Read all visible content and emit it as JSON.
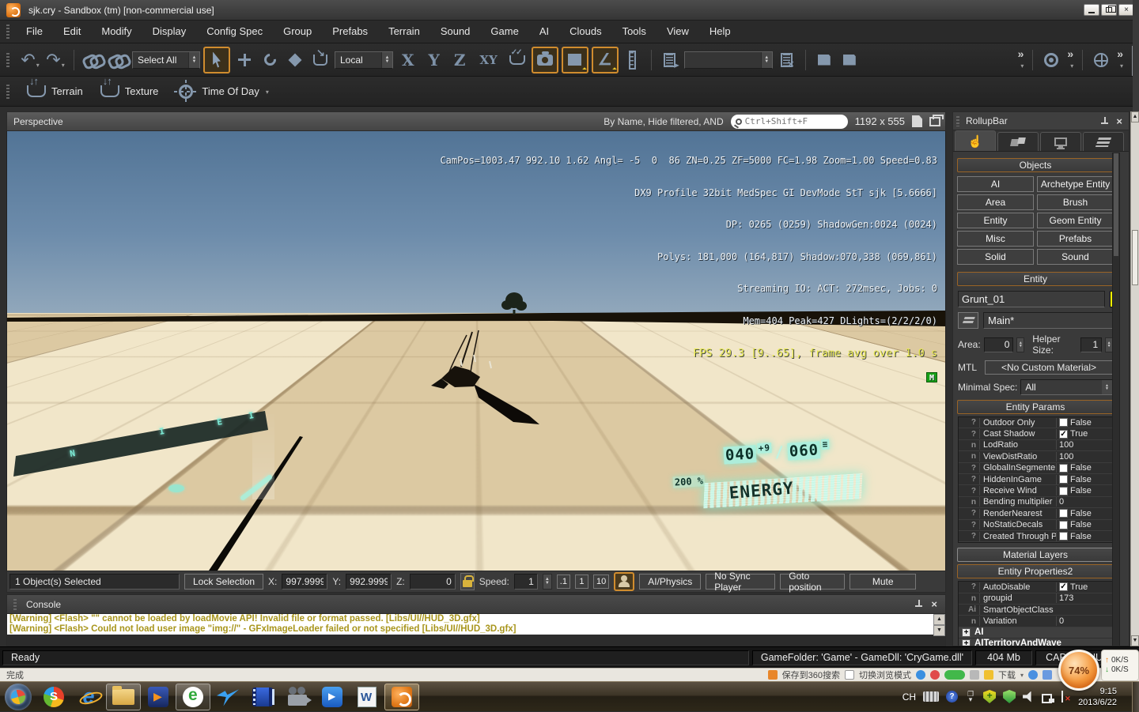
{
  "window": {
    "title": "sjk.cry - Sandbox (tm) [non-commercial use]"
  },
  "menu": [
    "File",
    "Edit",
    "Modify",
    "Display",
    "Config Spec",
    "Group",
    "Prefabs",
    "Terrain",
    "Sound",
    "Game",
    "AI",
    "Clouds",
    "Tools",
    "View",
    "Help"
  ],
  "toolbar": {
    "select_mode": "Select All",
    "coord_system": "Local",
    "axes": [
      "X",
      "Y",
      "Z",
      "XY"
    ],
    "overflow_glyph": "»"
  },
  "toolbar2": {
    "terrain": "Terrain",
    "texture": "Texture",
    "time_of_day": "Time Of Day"
  },
  "viewport": {
    "title": "Perspective",
    "filter_label": "By Name, Hide filtered, AND",
    "search_placeholder": "Ctrl+Shift+F",
    "resolution": "1192 x 555",
    "stats": [
      "CamPos=1003.47 992.10 1.62 Angl= -5  0  86 ZN=0.25 ZF=5000 FC=1.98 Zoom=1.00 Speed=0.83",
      "DX9 Profile 32bit MedSpec GI DevMode StT sjk [5.6666]",
      "DP: 0265 (0259) ShadowGen:0024 (0024)",
      "Polys: 181,000 (164,817) Shadow:070,338 (069,861)",
      "Streaming IO: ACT: 272msec, Jobs: 0",
      "Mem=404 Peak=427 DLights=(2/2/2/0)"
    ],
    "fps_line": "FPS 29.3 [9..65], frame avg over 1.0 s",
    "memory_badge": "M",
    "hud": {
      "ammo_left": "040",
      "ammo_mod": "+9",
      "ammo_sep": "/",
      "ammo_right": "060",
      "mag_glyph": "≡",
      "percent": "200 %",
      "energy_label": "ENERGY",
      "compass": [
        "N",
        "I",
        "E",
        "I"
      ]
    }
  },
  "selbar": {
    "selected_info": "1 Object(s) Selected",
    "lock_selection": "Lock Selection",
    "x_label": "X:",
    "x_value": "997.9999",
    "y_label": "Y:",
    "y_value": "992.9999",
    "z_label": "Z:",
    "z_value": "0",
    "speed_label": "Speed:",
    "speed_value": "1",
    "presets": [
      ".1",
      "1",
      "10"
    ],
    "buttons": [
      "AI/Physics",
      "No Sync Player",
      "Goto position",
      "Mute"
    ]
  },
  "console": {
    "title": "Console",
    "lines": [
      "[Warning] <Flash> \"\" cannot be loaded by loadMovie API! Invalid file or format passed. [Libs/UI//HUD_3D.gfx]",
      "[Warning] <Flash> Could not load user image \"img://\" - GFxImageLoader failed or not specified [Libs/UI//HUD_3D.gfx]"
    ]
  },
  "statusbar": {
    "ready": "Ready",
    "game_info": "GameFolder: 'Game' - GameDll: 'CryGame.dll'",
    "memory": "404 Mb",
    "cap": "CAP",
    "num": "NUM"
  },
  "rollup": {
    "title": "RollupBar",
    "objects_header": "Objects",
    "object_buttons": [
      "AI",
      "Archetype Entity",
      "Area",
      "Brush",
      "Entity",
      "Geom Entity",
      "Misc",
      "Prefabs",
      "Solid",
      "Sound"
    ],
    "entity_header": "Entity",
    "entity_name": "Grunt_01",
    "entity_color": "#ffff00",
    "layer_value": "Main*",
    "area_label": "Area:",
    "area_value": "0",
    "helper_label": "Helper Size:",
    "helper_value": "1",
    "mtl_label": "MTL",
    "mtl_value": "<No Custom Material>",
    "minspec_label": "Minimal Spec:",
    "minspec_value": "All",
    "params_header": "Entity Params",
    "params": [
      {
        "type": "?",
        "name": "Outdoor Only",
        "check": "",
        "value": "False"
      },
      {
        "type": "?",
        "name": "Cast Shadow",
        "check": "✓",
        "value": "True"
      },
      {
        "type": "n",
        "name": "LodRatio",
        "value": "100"
      },
      {
        "type": "n",
        "name": "ViewDistRatio",
        "value": "100"
      },
      {
        "type": "?",
        "name": "GlobalInSegmente",
        "check": "",
        "value": "False"
      },
      {
        "type": "?",
        "name": "HiddenInGame",
        "check": "",
        "value": "False"
      },
      {
        "type": "?",
        "name": "Receive Wind",
        "check": "",
        "value": "False"
      },
      {
        "type": "n",
        "name": "Bending multiplier",
        "value": "0"
      },
      {
        "type": "?",
        "name": "RenderNearest",
        "check": "",
        "value": "False"
      },
      {
        "type": "?",
        "name": "NoStaticDecals",
        "check": "",
        "value": "False"
      },
      {
        "type": "?",
        "name": "Created Through P",
        "check": "",
        "value": "False"
      }
    ],
    "material_header": "Material Layers",
    "props2_header": "Entity Properties2",
    "props2": [
      {
        "type": "?",
        "name": "AutoDisable",
        "check": "✓",
        "value": "True"
      },
      {
        "type": "n",
        "name": "groupid",
        "value": "173"
      },
      {
        "type": "Ai",
        "name": "SmartObjectClass",
        "value": ""
      },
      {
        "type": "n",
        "name": "Variation",
        "value": "0"
      }
    ],
    "prop_groups": [
      "AI",
      "AITerritoryAndWave"
    ]
  },
  "browser": {
    "status": "完成",
    "save_label": "保存到360搜索",
    "mode_label": "切换浏览模式",
    "download_label": "下载"
  },
  "net_overlay": {
    "percent": "74%",
    "upload": "0K/S",
    "download": "0K/S"
  },
  "taskbar": {
    "tray_lang": "CH",
    "clock_time": "9:15",
    "clock_date": "2013/6/22"
  },
  "colors": {
    "accent_orange": "#d08c2e",
    "entity_swatch": "#ffff00",
    "hud_cyan": "#9fe8d6",
    "fps_yellow": "#e9e94e",
    "sky_top": "#527496",
    "sky_bottom": "#93a9bc",
    "ground_light": "#f1e6c9",
    "ground_dark": "#dcc9a2"
  }
}
